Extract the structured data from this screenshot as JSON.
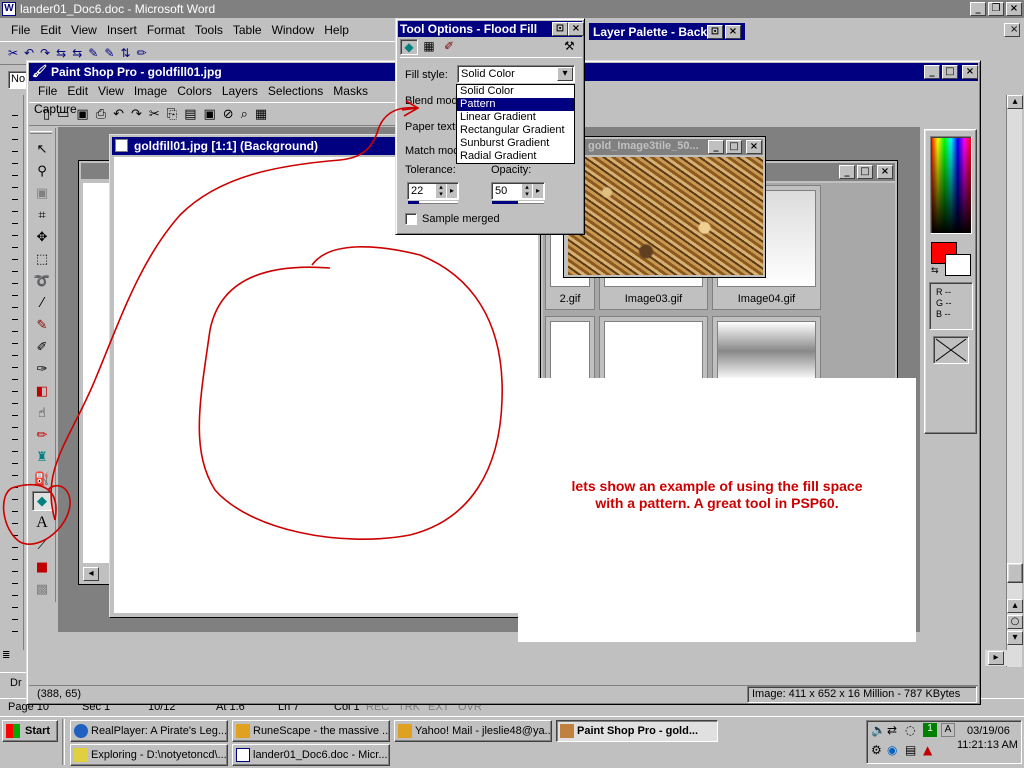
{
  "word": {
    "title": "lander01_Doc6.doc - Microsoft Word",
    "menu": [
      "File",
      "Edit",
      "View",
      "Insert",
      "Format",
      "Tools",
      "Table",
      "Window",
      "Help"
    ],
    "style_box": "No",
    "status_left": "Page 10",
    "status_sec": "Sec 1",
    "status_pages": "10/12",
    "status_at": "At 1.6\"",
    "status_ln": "Ln 7",
    "status_col": "Col 1",
    "status_modes": [
      "REC",
      "TRK",
      "EXT",
      "OVR"
    ],
    "draw_label": "Dr"
  },
  "psp": {
    "title": "Paint Shop Pro - goldfill01.jpg",
    "menu": [
      "File",
      "Edit",
      "View",
      "Image",
      "Colors",
      "Layers",
      "Selections",
      "Masks",
      "Capture"
    ],
    "status_coords": "(388, 65)",
    "status_image": "Image:  411 x 652 x 16 Million - 787 KBytes"
  },
  "image_window": {
    "title": "goldfill01.jpg [1:1] (Background)"
  },
  "tile_window": {
    "title": "gold_Image3tile_50..."
  },
  "browser_window": {
    "thumbs": [
      "2.gif",
      "Image03.gif",
      "Image04.gif"
    ]
  },
  "tool_options": {
    "title": "Tool Options - Flood Fill",
    "fill_style_label": "Fill style:",
    "fill_style_value": "Solid Color",
    "blend_label": "Blend mod",
    "paper_label": "Paper textu",
    "match_label": "Match moc",
    "dropdown_options": [
      "Solid Color",
      "Pattern",
      "Linear Gradient",
      "Rectangular Gradient",
      "Sunburst Gradient",
      "Radial Gradient"
    ],
    "tolerance_label": "Tolerance:",
    "tolerance_value": "22",
    "opacity_label": "Opacity:",
    "opacity_value": "50",
    "sample_merged": "Sample merged"
  },
  "layer_palette": {
    "title": "Layer Palette - Backg"
  },
  "color_panel": {
    "r": "R --",
    "g": "G --",
    "b": "B --"
  },
  "annotation": {
    "line1": "lets show an example of using the fill space",
    "line2": "with a pattern.  A great tool in PSP60.",
    "color": "#cc0000"
  },
  "taskbar": {
    "start": "Start",
    "buttons": [
      "RealPlayer: A Pirate's Leg...",
      "RuneScape - the massive ...",
      "Yahoo! Mail - jleslie48@ya...",
      "Paint Shop Pro - gold...",
      "Exploring - D:\\notyetoncd\\...",
      "lander01_Doc6.doc - Micr..."
    ],
    "date": "03/19/06",
    "time": "11:21:13 AM"
  }
}
